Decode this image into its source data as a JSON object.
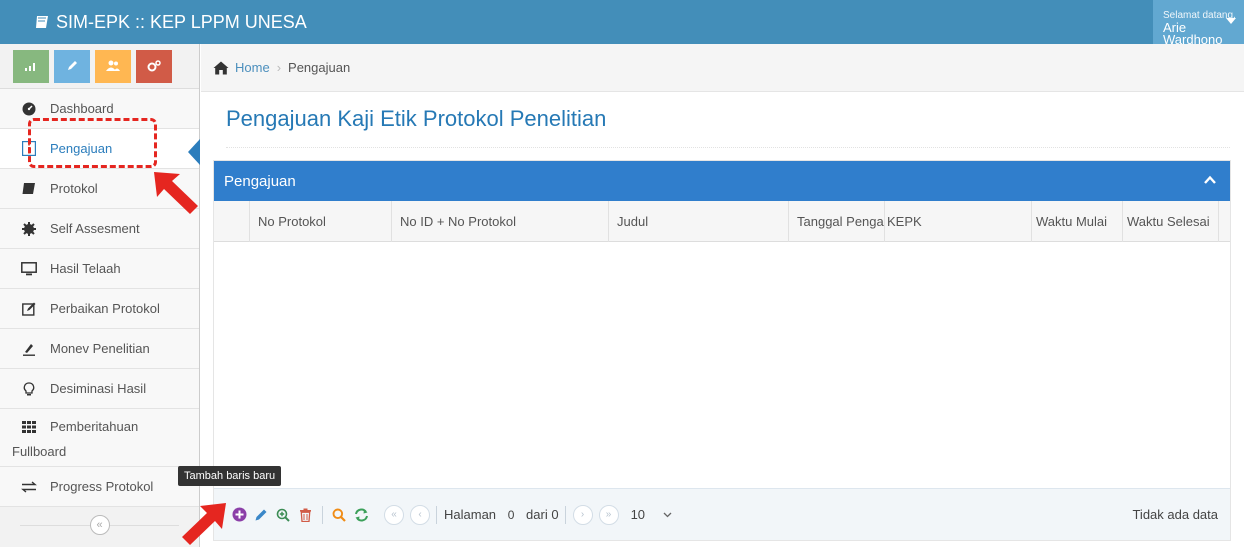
{
  "app": {
    "title": "SIM-EPK :: KEP LPPM UNESA"
  },
  "user": {
    "greeting": "Selamat datang,",
    "name": "Arie Wardhono"
  },
  "sidebar": {
    "shortcuts": [
      "stats",
      "edit",
      "users",
      "settings"
    ],
    "items": [
      {
        "label": "Dashboard",
        "icon": "tachometer-icon"
      },
      {
        "label": "Pengajuan",
        "icon": "info-icon",
        "active": true
      },
      {
        "label": "Protokol",
        "icon": "book-icon"
      },
      {
        "label": "Self Assesment",
        "icon": "gear-icon"
      },
      {
        "label": "Hasil Telaah",
        "icon": "desktop-icon"
      },
      {
        "label": "Perbaikan Protokol",
        "icon": "edit-icon"
      },
      {
        "label": "Monev Penelitian",
        "icon": "eyedropper-icon"
      },
      {
        "label": "Desiminasi Hasil",
        "icon": "lightbulb-icon"
      },
      {
        "label_line1": "Pemberitahuan",
        "label_line2": "Fullboard",
        "icon": "grid-icon"
      },
      {
        "label": "Progress Protokol",
        "icon": "exchange-icon"
      }
    ],
    "collapse_glyph": "«"
  },
  "breadcrumb": {
    "home": "Home",
    "current": "Pengajuan"
  },
  "page": {
    "title": "Pengajuan Kaji Etik Protokol Penelitian"
  },
  "grid": {
    "caption": "Pengajuan",
    "columns": [
      "No Protokol",
      "No ID + No Protokol",
      "Judul",
      "Tanggal Penga",
      "KEPK",
      "Waktu Mulai",
      "Waktu Selesai"
    ],
    "rows": []
  },
  "pager": {
    "page_label": "Halaman",
    "page_value": "0",
    "of_label": "dari 0",
    "rows_per_page": "10",
    "empty_text": "Tidak ada data",
    "first": "«",
    "prev": "‹",
    "next": "›",
    "last": "»"
  },
  "tooltip": {
    "text": "Tambah baris baru"
  },
  "colors": {
    "navbar": "#438eb9",
    "panel_header": "#307ecc",
    "annotation": "#e52620"
  }
}
